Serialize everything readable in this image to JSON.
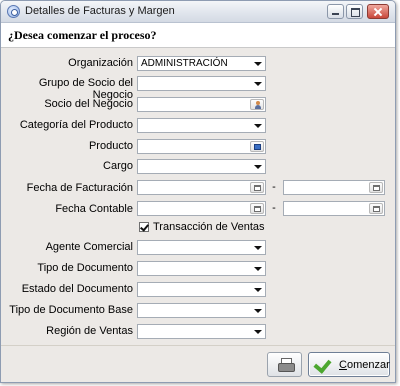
{
  "window": {
    "title": "Detalles de Facturas y Margen"
  },
  "header": {
    "question": "¿Desea comenzar el proceso?"
  },
  "form": {
    "organizacion": {
      "label": "Organización",
      "value": "ADMINISTRACIÓN"
    },
    "grupo_socio": {
      "label": "Grupo de Socio del Negocio",
      "value": ""
    },
    "socio": {
      "label": "Socio del Negocio",
      "value": ""
    },
    "categoria": {
      "label": "Categoría del Producto",
      "value": ""
    },
    "producto": {
      "label": "Producto",
      "value": ""
    },
    "cargo": {
      "label": "Cargo",
      "value": ""
    },
    "fecha_facturacion": {
      "label": "Fecha de Facturación",
      "from": "",
      "to": "",
      "separator": "-"
    },
    "fecha_contable": {
      "label": "Fecha Contable",
      "from": "",
      "to": "",
      "separator": "-"
    },
    "transaccion_ventas": {
      "label": "Transacción de Ventas",
      "checked": true
    },
    "agente": {
      "label": "Agente Comercial",
      "value": ""
    },
    "tipo_doc": {
      "label": "Tipo de Documento",
      "value": ""
    },
    "estado_doc": {
      "label": "Estado del Documento",
      "value": ""
    },
    "tipo_doc_base": {
      "label": "Tipo de Documento Base",
      "value": ""
    },
    "region": {
      "label": "Región de Ventas",
      "value": ""
    }
  },
  "buttons": {
    "start_mnemonic": "C",
    "start_rest": "omenzar"
  },
  "icons": {
    "window": "settings-gear-icon",
    "minimize": "minimize-icon",
    "maximize": "maximize-icon",
    "close": "close-icon",
    "bpartner": "person-icon",
    "product": "product-icon",
    "calendar": "calendar-icon",
    "print": "printer-icon",
    "start": "checkmark-icon"
  }
}
